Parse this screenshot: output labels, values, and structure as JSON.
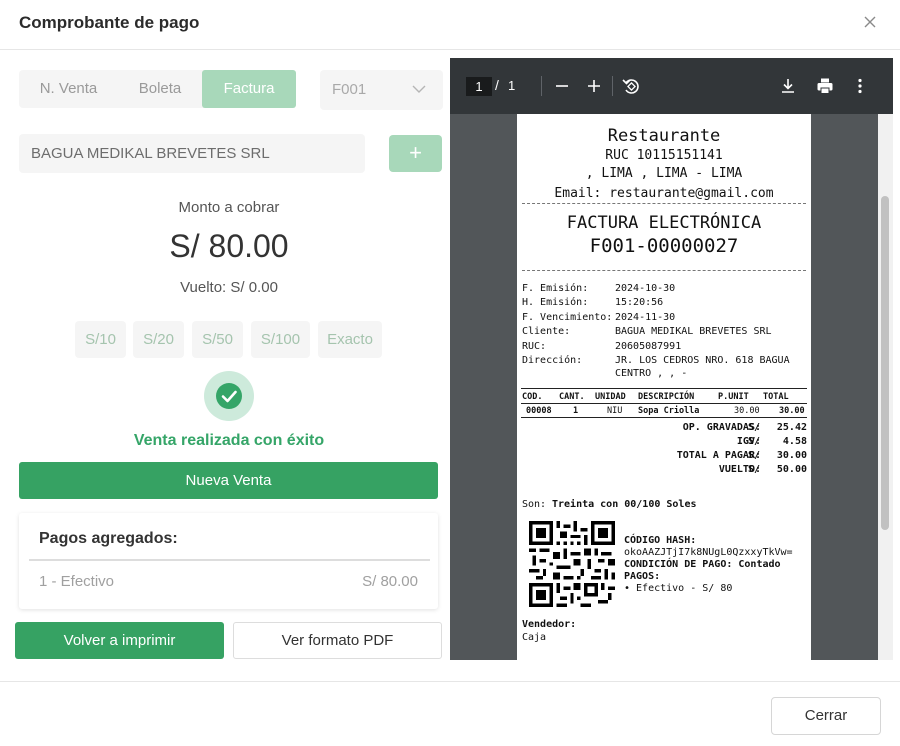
{
  "modal": {
    "title": "Comprobante de pago",
    "close_button": "Cerrar"
  },
  "doc_types": [
    "N. Venta",
    "Boleta",
    "Factura"
  ],
  "doc_type_selected": "Factura",
  "serie": "F001",
  "client": "BAGUA MEDIKAL BREVETES SRL",
  "add_label": "+",
  "amount": {
    "label": "Monto a cobrar",
    "value": "S/ 80.00",
    "change": "Vuelto: S/ 0.00"
  },
  "quick_amounts": [
    "S/10",
    "S/20",
    "S/50",
    "S/100",
    "Exacto"
  ],
  "success_message": "Venta realizada con éxito",
  "new_sale_button": "Nueva Venta",
  "payments": {
    "title": "Pagos agregados:",
    "items": [
      {
        "name": "1 - Efectivo",
        "amount": "S/ 80.00"
      }
    ]
  },
  "actions": {
    "reprint": "Volver a imprimir",
    "pdf": "Ver formato PDF"
  },
  "viewer": {
    "page": "1",
    "separator": "/",
    "total": "1",
    "icons": [
      "zoom-out-icon",
      "zoom-in-icon",
      "rotate-icon",
      "download-icon",
      "print-icon",
      "more-icon"
    ]
  },
  "receipt": {
    "business": "Restaurante",
    "ruc": "RUC 10115151141",
    "address": ", LIMA , LIMA - LIMA",
    "email": "Email: restaurante@gmail.com",
    "doc_title": "FACTURA ELECTRÓNICA",
    "doc_number": "F001-00000027",
    "info": [
      {
        "k": "F. Emisión:",
        "v": "2024-10-30"
      },
      {
        "k": "H. Emisión:",
        "v": "15:20:56"
      },
      {
        "k": "F. Vencimiento:",
        "v": "2024-11-30"
      },
      {
        "k": "Cliente:",
        "v": "BAGUA MEDIKAL BREVETES SRL"
      },
      {
        "k": "RUC:",
        "v": "20605087991"
      },
      {
        "k": "Dirección:",
        "v": "JR. LOS CEDROS NRO. 618 BAGUA"
      },
      {
        "k": "",
        "v": "CENTRO , , -"
      }
    ],
    "columns": [
      "COD.",
      "CANT.",
      "UNIDAD",
      "DESCRIPCIÓN",
      "P.UNIT",
      "TOTAL"
    ],
    "rows": [
      [
        "00008",
        "1",
        "NIU",
        "Sopa Criolla",
        "30.00",
        "30.00"
      ]
    ],
    "totals": [
      {
        "label": "OP. GRAVADAS:",
        "cur": "S/",
        "value": "25.42"
      },
      {
        "label": "IGV:",
        "cur": "S/",
        "value": "4.58"
      },
      {
        "label": "TOTAL A PAGAR:",
        "cur": "S/",
        "value": "30.00"
      },
      {
        "label": "VUELTO:",
        "cur": "S/",
        "value": "50.00"
      }
    ],
    "son_label": "Son:",
    "son_value": "Treinta con 00/100 Soles",
    "hash_label": "CÓDIGO HASH:",
    "hash_value": "okoAAZJTjI7k8NUgL0QzxxyTkVw=",
    "condition": "CONDICIÓN DE PAGO: Contado",
    "payments_label": "PAGOS:",
    "payment_line": "• Efectivo - S/ 80",
    "seller_label": "Vendedor:",
    "seller": "Caja"
  }
}
